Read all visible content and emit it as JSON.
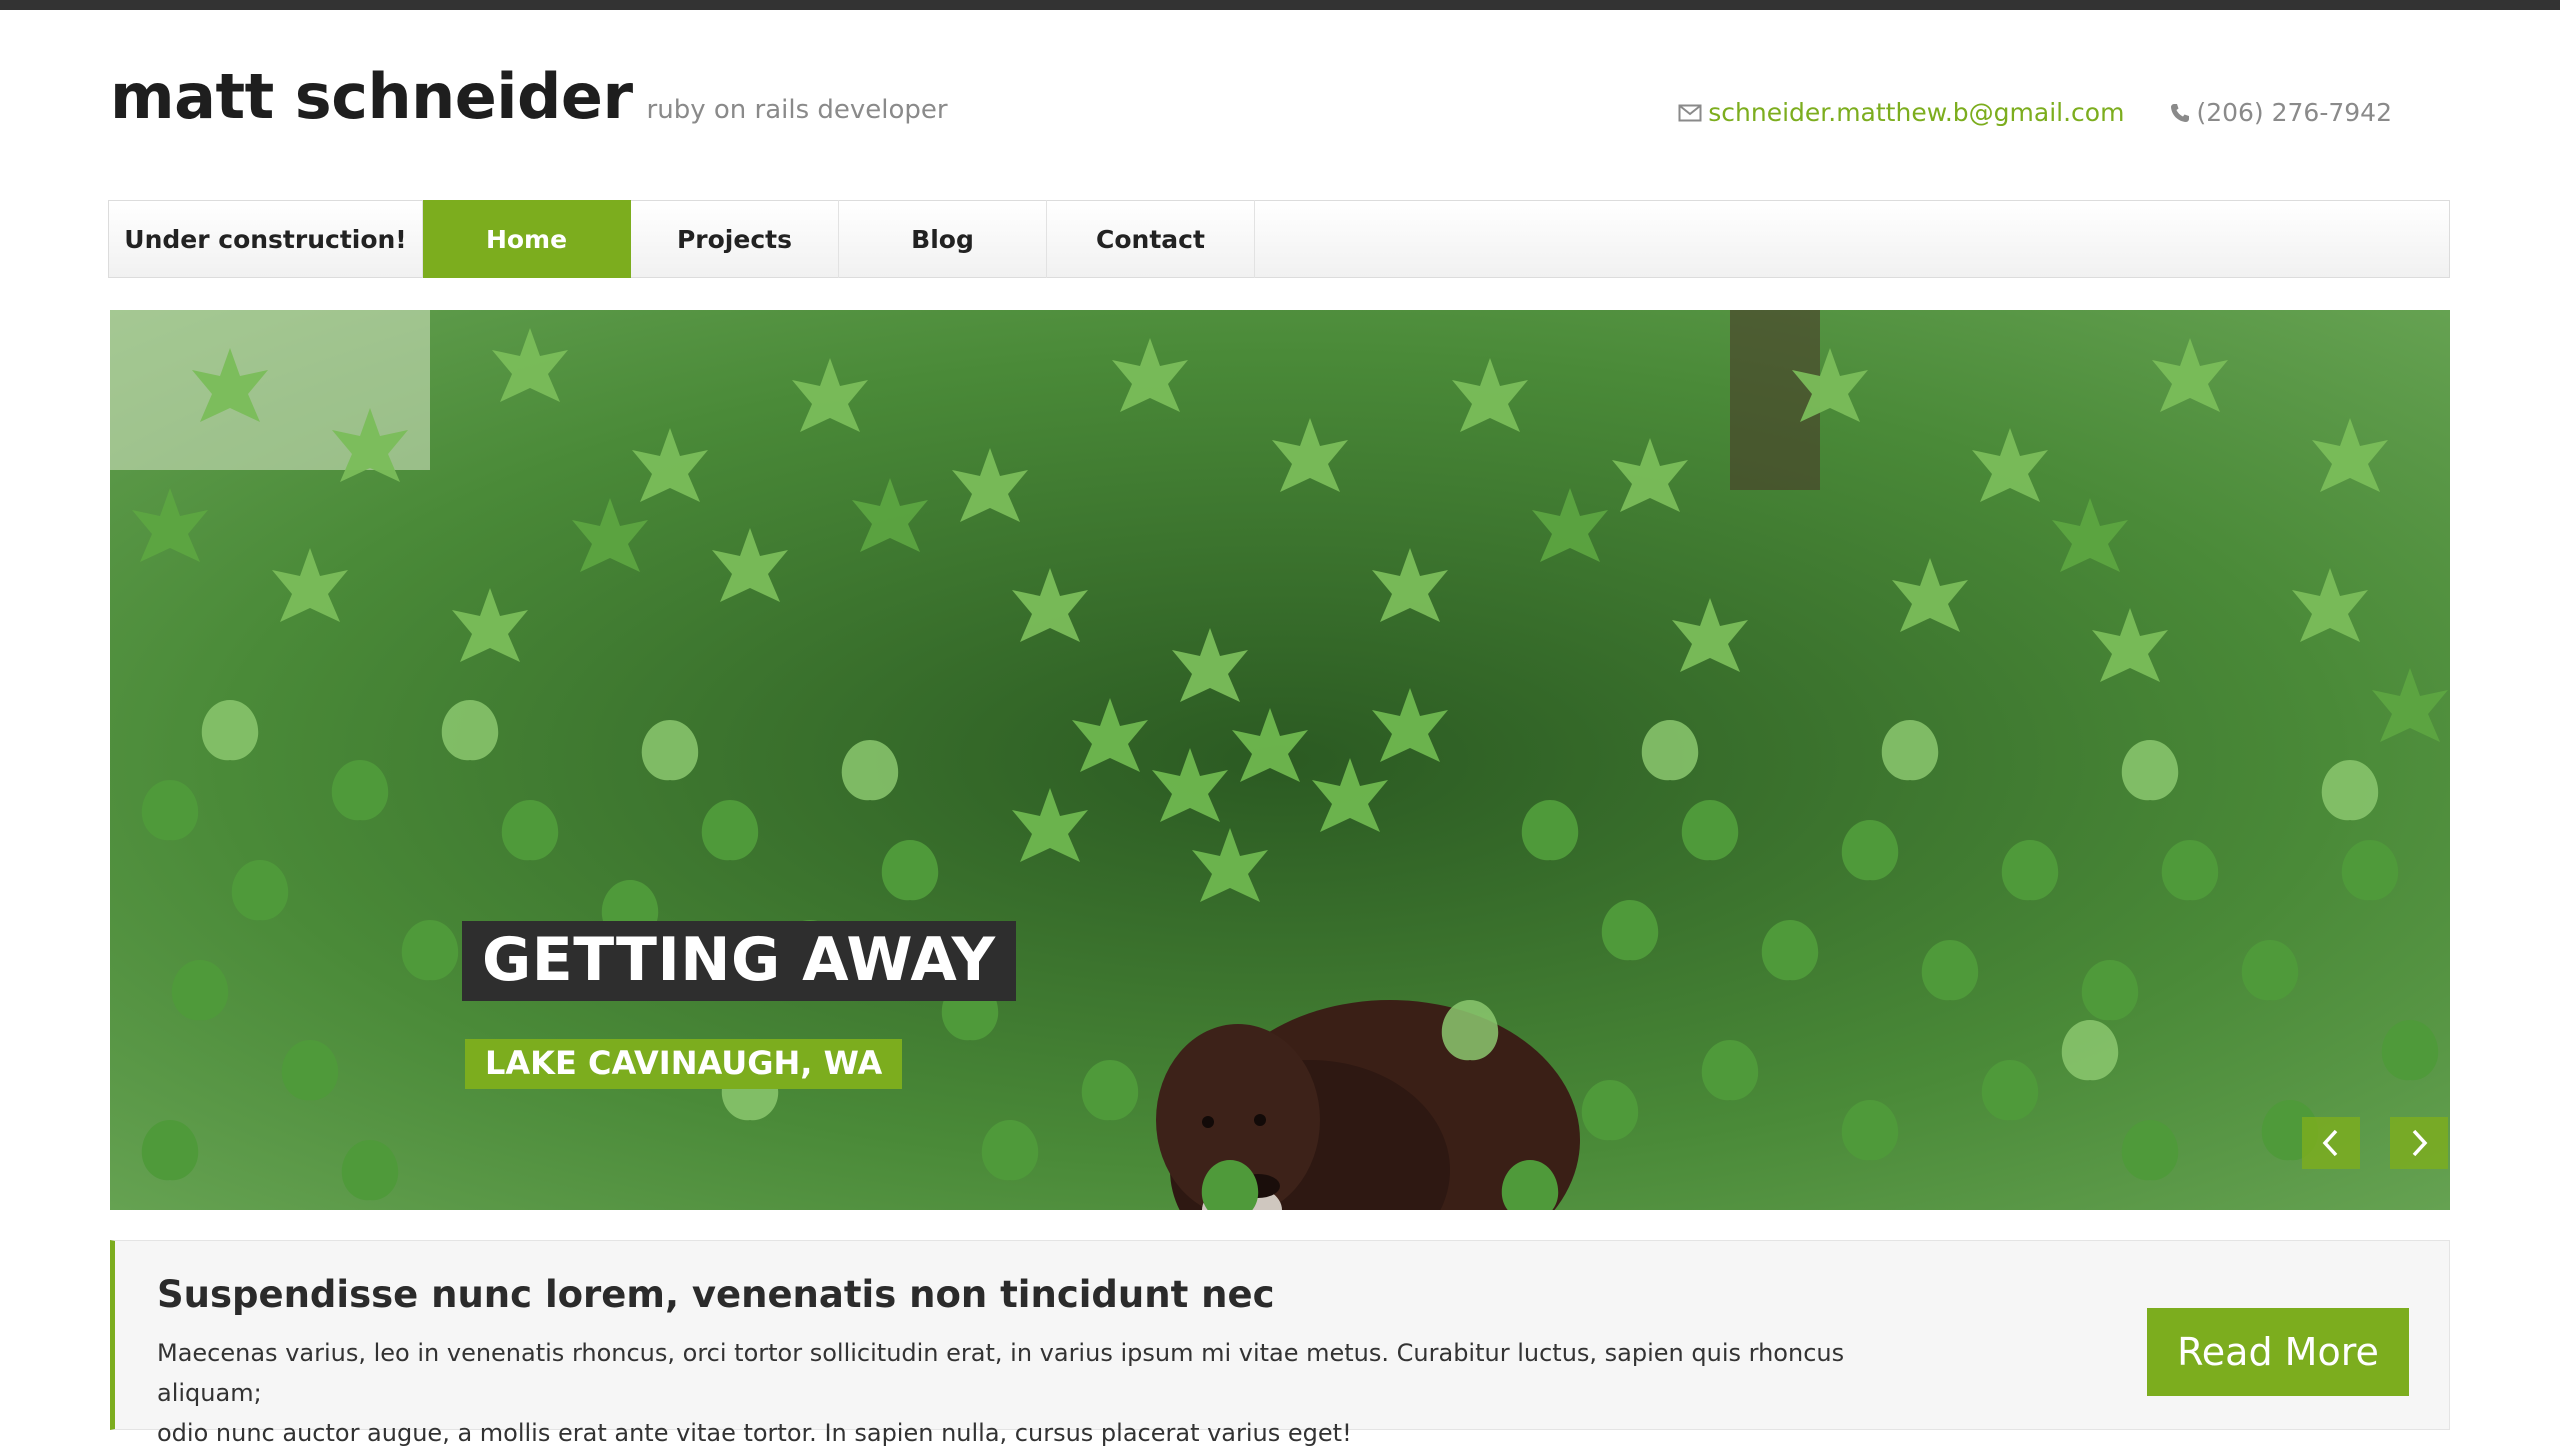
{
  "header": {
    "site_title": "matt schneider",
    "tagline": "ruby on rails developer",
    "email": "schneider.matthew.b@gmail.com",
    "phone": "(206) 276-7942",
    "email_icon": "envelope-icon",
    "phone_icon": "phone-icon"
  },
  "nav": {
    "items": [
      {
        "label": "Under construction!",
        "active": false
      },
      {
        "label": "Home",
        "active": true
      },
      {
        "label": "Projects",
        "active": false
      },
      {
        "label": "Blog",
        "active": false
      },
      {
        "label": "Contact",
        "active": false
      }
    ]
  },
  "slider": {
    "caption_title": "GETTING AWAY",
    "caption_subtitle": "LAKE CAVINAUGH, WA",
    "prev_icon": "chevron-left-icon",
    "next_icon": "chevron-right-icon",
    "image_subject": "dog hiding in ivy and maple leaves"
  },
  "callout": {
    "heading": "Suspendisse nunc lorem, venenatis non tincidunt nec",
    "text_line1": "Maecenas varius, leo in venenatis rhoncus, orci tortor sollicitudin erat, in varius ipsum mi vitae metus. Curabitur luctus, sapien quis rhoncus aliquam;",
    "text_line2": "odio nunc auctor augue, a mollis erat ante vitae tortor. In sapien nulla, cursus placerat varius eget!",
    "button_label": "Read More"
  },
  "colors": {
    "accent": "#7cad1e",
    "dark": "#2e2e2e",
    "topbar": "#333333",
    "muted": "#8a8a8a"
  }
}
